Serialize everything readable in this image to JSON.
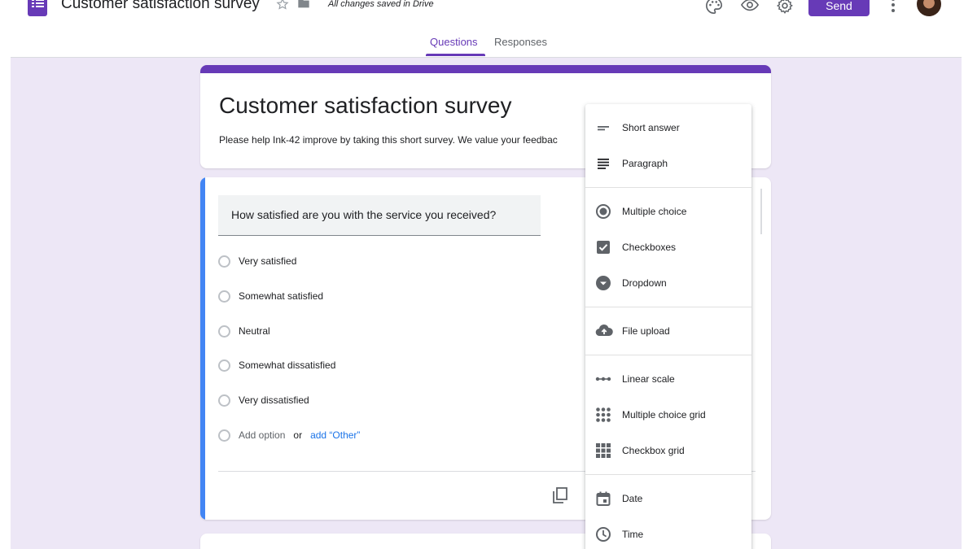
{
  "header": {
    "doc_title": "Customer satisfaction survey",
    "saved_status": "All changes saved in Drive",
    "send_label": "Send",
    "icons": [
      "forms-logo-icon",
      "star-icon",
      "folder-icon",
      "palette-icon",
      "preview-eye-icon",
      "settings-gear-icon",
      "more-vert-icon",
      "avatar"
    ]
  },
  "tabs": [
    {
      "label": "Questions",
      "active": true
    },
    {
      "label": "Responses",
      "active": false
    }
  ],
  "form": {
    "title": "Customer satisfaction survey",
    "description": "Please help Ink-42 improve by taking this short survey. We value your feedbac"
  },
  "question": {
    "text": "How satisfied are you with the service you received?",
    "options": [
      "Very satisfied",
      "Somewhat satisfied",
      "Neutral",
      "Somewhat dissatisfied",
      "Very dissatisfied"
    ],
    "add_option": "Add option",
    "or": "or",
    "add_other": "add “Other”"
  },
  "menu": {
    "items": [
      {
        "label": "Short answer",
        "icon": "short-answer-icon"
      },
      {
        "label": "Paragraph",
        "icon": "paragraph-icon"
      },
      {
        "label": "Multiple choice",
        "icon": "radio-button-icon"
      },
      {
        "label": "Checkboxes",
        "icon": "checkbox-icon"
      },
      {
        "label": "Dropdown",
        "icon": "dropdown-icon"
      },
      {
        "label": "File upload",
        "icon": "cloud-upload-icon"
      },
      {
        "label": "Linear scale",
        "icon": "linear-scale-icon"
      },
      {
        "label": "Multiple choice grid",
        "icon": "dot-grid-icon"
      },
      {
        "label": "Checkbox grid",
        "icon": "checkbox-grid-icon"
      },
      {
        "label": "Date",
        "icon": "calendar-icon"
      },
      {
        "label": "Time",
        "icon": "clock-icon"
      }
    ]
  },
  "colors": {
    "brand": "#673ab7",
    "background": "#ede7f6",
    "accent_blue": "#4285f4",
    "link": "#1a73e8"
  }
}
